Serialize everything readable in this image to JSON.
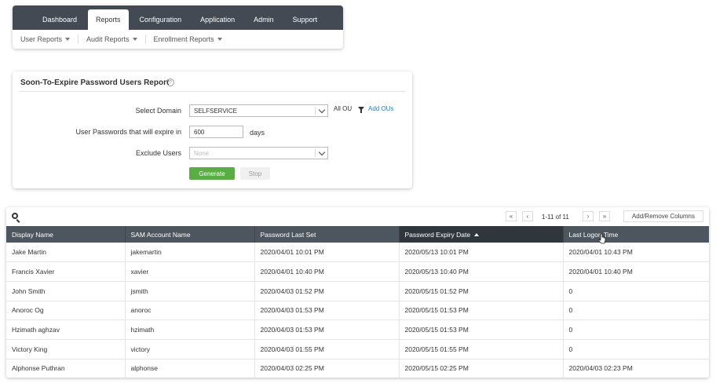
{
  "nav": {
    "tabs": [
      {
        "label": "Dashboard"
      },
      {
        "label": "Reports"
      },
      {
        "label": "Configuration"
      },
      {
        "label": "Application"
      },
      {
        "label": "Admin"
      },
      {
        "label": "Support"
      }
    ],
    "active_tab": "Reports",
    "sub_items": [
      {
        "label": "User Reports"
      },
      {
        "label": "Audit Reports"
      },
      {
        "label": "Enrollment Reports"
      }
    ]
  },
  "report_form": {
    "title": "Soon-To-Expire Password Users Report",
    "help_glyph": "?",
    "domain_label": "Select Domain",
    "domain_value": "SELFSERVICE",
    "all_ou": "All OU",
    "add_ous": "Add OUs",
    "expire_label": "User Passwords that will expire in",
    "expire_value": "600",
    "days_label": "days",
    "exclude_label": "Exclude Users",
    "exclude_placeholder": "None",
    "generate_label": "Generate",
    "stop_label": "Stop"
  },
  "results": {
    "pager": {
      "first": "«",
      "prev": "‹",
      "range": "1-11 of 11",
      "next": "›",
      "last": "»"
    },
    "add_remove_label": "Add/Remove Columns",
    "columns": [
      "Display Name",
      "SAM Account Name",
      "Password Last Set",
      "Password Expiry Date",
      "Last Logon Time"
    ],
    "sorted_column": "Password Expiry Date",
    "rows": [
      [
        "Jake Martin",
        "jakemartin",
        "2020/04/01 10:01 PM",
        "2020/05/13 10:01 PM",
        "2020/04/01 10:43 PM"
      ],
      [
        "Francis Xavier",
        "xavier",
        "2020/04/01 10:40 PM",
        "2020/05/13 10:40 PM",
        "2020/04/01 10:40 PM"
      ],
      [
        "John Smith",
        "jsmith",
        "2020/04/03 01:52 PM",
        "2020/05/15 01:52 PM",
        "0"
      ],
      [
        "Anoroc Og",
        "anoroc",
        "2020/04/03 01:53 PM",
        "2020/05/15 01:53 PM",
        "0"
      ],
      [
        "Hzimath aghzav",
        "hzimath",
        "2020/04/03 01:53 PM",
        "2020/05/15 01:53 PM",
        "0"
      ],
      [
        "Victory King",
        "victory",
        "2020/04/03 01:55 PM",
        "2020/05/15 01:55 PM",
        "0"
      ],
      [
        "Alphonse Puthran",
        "alphonse",
        "2020/04/03 02:25 PM",
        "2020/05/15 02:25 PM",
        "2020/04/03 02:23 PM"
      ]
    ]
  },
  "colors": {
    "nav_bg": "#434a54",
    "table_header_bg": "#4d565e",
    "sorted_header_bg": "#2f363c",
    "generate_bg": "#5aac44",
    "link": "#2b7bc0"
  }
}
